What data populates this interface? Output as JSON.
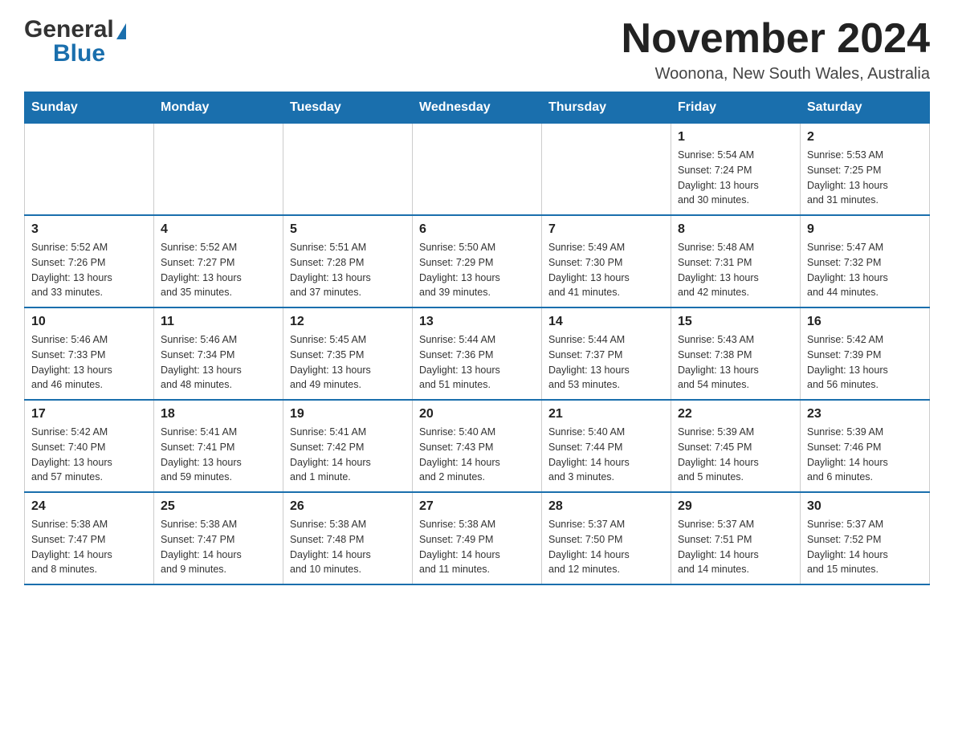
{
  "header": {
    "logo_general": "General",
    "logo_blue": "Blue",
    "main_title": "November 2024",
    "subtitle": "Woonona, New South Wales, Australia"
  },
  "calendar": {
    "days_of_week": [
      "Sunday",
      "Monday",
      "Tuesday",
      "Wednesday",
      "Thursday",
      "Friday",
      "Saturday"
    ],
    "weeks": [
      [
        {
          "day": "",
          "info": ""
        },
        {
          "day": "",
          "info": ""
        },
        {
          "day": "",
          "info": ""
        },
        {
          "day": "",
          "info": ""
        },
        {
          "day": "",
          "info": ""
        },
        {
          "day": "1",
          "info": "Sunrise: 5:54 AM\nSunset: 7:24 PM\nDaylight: 13 hours\nand 30 minutes."
        },
        {
          "day": "2",
          "info": "Sunrise: 5:53 AM\nSunset: 7:25 PM\nDaylight: 13 hours\nand 31 minutes."
        }
      ],
      [
        {
          "day": "3",
          "info": "Sunrise: 5:52 AM\nSunset: 7:26 PM\nDaylight: 13 hours\nand 33 minutes."
        },
        {
          "day": "4",
          "info": "Sunrise: 5:52 AM\nSunset: 7:27 PM\nDaylight: 13 hours\nand 35 minutes."
        },
        {
          "day": "5",
          "info": "Sunrise: 5:51 AM\nSunset: 7:28 PM\nDaylight: 13 hours\nand 37 minutes."
        },
        {
          "day": "6",
          "info": "Sunrise: 5:50 AM\nSunset: 7:29 PM\nDaylight: 13 hours\nand 39 minutes."
        },
        {
          "day": "7",
          "info": "Sunrise: 5:49 AM\nSunset: 7:30 PM\nDaylight: 13 hours\nand 41 minutes."
        },
        {
          "day": "8",
          "info": "Sunrise: 5:48 AM\nSunset: 7:31 PM\nDaylight: 13 hours\nand 42 minutes."
        },
        {
          "day": "9",
          "info": "Sunrise: 5:47 AM\nSunset: 7:32 PM\nDaylight: 13 hours\nand 44 minutes."
        }
      ],
      [
        {
          "day": "10",
          "info": "Sunrise: 5:46 AM\nSunset: 7:33 PM\nDaylight: 13 hours\nand 46 minutes."
        },
        {
          "day": "11",
          "info": "Sunrise: 5:46 AM\nSunset: 7:34 PM\nDaylight: 13 hours\nand 48 minutes."
        },
        {
          "day": "12",
          "info": "Sunrise: 5:45 AM\nSunset: 7:35 PM\nDaylight: 13 hours\nand 49 minutes."
        },
        {
          "day": "13",
          "info": "Sunrise: 5:44 AM\nSunset: 7:36 PM\nDaylight: 13 hours\nand 51 minutes."
        },
        {
          "day": "14",
          "info": "Sunrise: 5:44 AM\nSunset: 7:37 PM\nDaylight: 13 hours\nand 53 minutes."
        },
        {
          "day": "15",
          "info": "Sunrise: 5:43 AM\nSunset: 7:38 PM\nDaylight: 13 hours\nand 54 minutes."
        },
        {
          "day": "16",
          "info": "Sunrise: 5:42 AM\nSunset: 7:39 PM\nDaylight: 13 hours\nand 56 minutes."
        }
      ],
      [
        {
          "day": "17",
          "info": "Sunrise: 5:42 AM\nSunset: 7:40 PM\nDaylight: 13 hours\nand 57 minutes."
        },
        {
          "day": "18",
          "info": "Sunrise: 5:41 AM\nSunset: 7:41 PM\nDaylight: 13 hours\nand 59 minutes."
        },
        {
          "day": "19",
          "info": "Sunrise: 5:41 AM\nSunset: 7:42 PM\nDaylight: 14 hours\nand 1 minute."
        },
        {
          "day": "20",
          "info": "Sunrise: 5:40 AM\nSunset: 7:43 PM\nDaylight: 14 hours\nand 2 minutes."
        },
        {
          "day": "21",
          "info": "Sunrise: 5:40 AM\nSunset: 7:44 PM\nDaylight: 14 hours\nand 3 minutes."
        },
        {
          "day": "22",
          "info": "Sunrise: 5:39 AM\nSunset: 7:45 PM\nDaylight: 14 hours\nand 5 minutes."
        },
        {
          "day": "23",
          "info": "Sunrise: 5:39 AM\nSunset: 7:46 PM\nDaylight: 14 hours\nand 6 minutes."
        }
      ],
      [
        {
          "day": "24",
          "info": "Sunrise: 5:38 AM\nSunset: 7:47 PM\nDaylight: 14 hours\nand 8 minutes."
        },
        {
          "day": "25",
          "info": "Sunrise: 5:38 AM\nSunset: 7:47 PM\nDaylight: 14 hours\nand 9 minutes."
        },
        {
          "day": "26",
          "info": "Sunrise: 5:38 AM\nSunset: 7:48 PM\nDaylight: 14 hours\nand 10 minutes."
        },
        {
          "day": "27",
          "info": "Sunrise: 5:38 AM\nSunset: 7:49 PM\nDaylight: 14 hours\nand 11 minutes."
        },
        {
          "day": "28",
          "info": "Sunrise: 5:37 AM\nSunset: 7:50 PM\nDaylight: 14 hours\nand 12 minutes."
        },
        {
          "day": "29",
          "info": "Sunrise: 5:37 AM\nSunset: 7:51 PM\nDaylight: 14 hours\nand 14 minutes."
        },
        {
          "day": "30",
          "info": "Sunrise: 5:37 AM\nSunset: 7:52 PM\nDaylight: 14 hours\nand 15 minutes."
        }
      ]
    ]
  }
}
